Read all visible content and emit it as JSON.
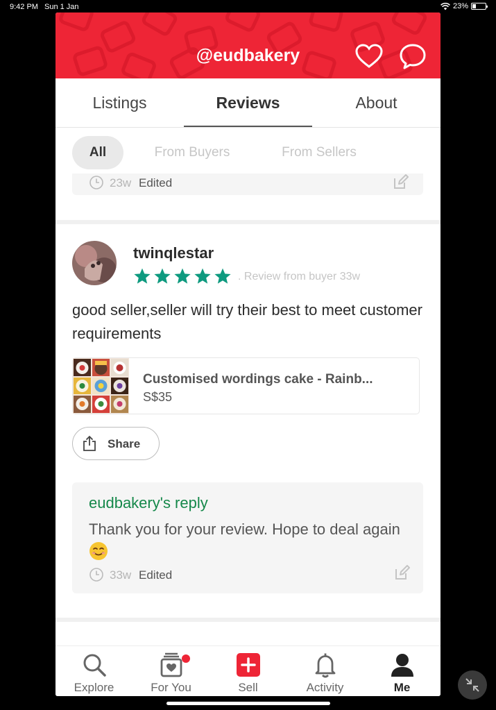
{
  "status_bar": {
    "time": "9:42 PM",
    "date": "Sun 1 Jan",
    "battery": "23%"
  },
  "header": {
    "title": "@eudbakery",
    "brand_color": "#ee2536"
  },
  "tabs": [
    {
      "label": "Listings"
    },
    {
      "label": "Reviews",
      "selected": true
    },
    {
      "label": "About"
    }
  ],
  "filters": [
    {
      "label": "All",
      "selected": true
    },
    {
      "label": "From Buyers"
    },
    {
      "label": "From Sellers"
    }
  ],
  "previous_reply": {
    "time": "23w",
    "edited": "Edited"
  },
  "review": {
    "username": "twinqlestar",
    "rating": 5,
    "meta": ". Review from buyer  33w",
    "text": "good seller,seller will try their best to meet customer requirements",
    "listing": {
      "title": "Customised wordings cake - Rainb...",
      "price": "S$35"
    },
    "share_label": "Share",
    "reply": {
      "title": "eudbakery's reply",
      "text": "Thank you for your review. Hope to deal again",
      "emoji": "smiling-face-icon",
      "time": "33w",
      "edited": "Edited"
    }
  },
  "bottom_nav": [
    {
      "label": "Explore",
      "icon": "search-icon"
    },
    {
      "label": "For You",
      "icon": "for-you-icon",
      "has_notification": true
    },
    {
      "label": "Sell",
      "icon": "plus-icon"
    },
    {
      "label": "Activity",
      "icon": "bell-icon"
    },
    {
      "label": "Me",
      "icon": "user-icon",
      "selected": true
    }
  ],
  "colors": {
    "accent": "#ee2536",
    "star": "#0e9a7f",
    "reply_title": "#15884a"
  }
}
